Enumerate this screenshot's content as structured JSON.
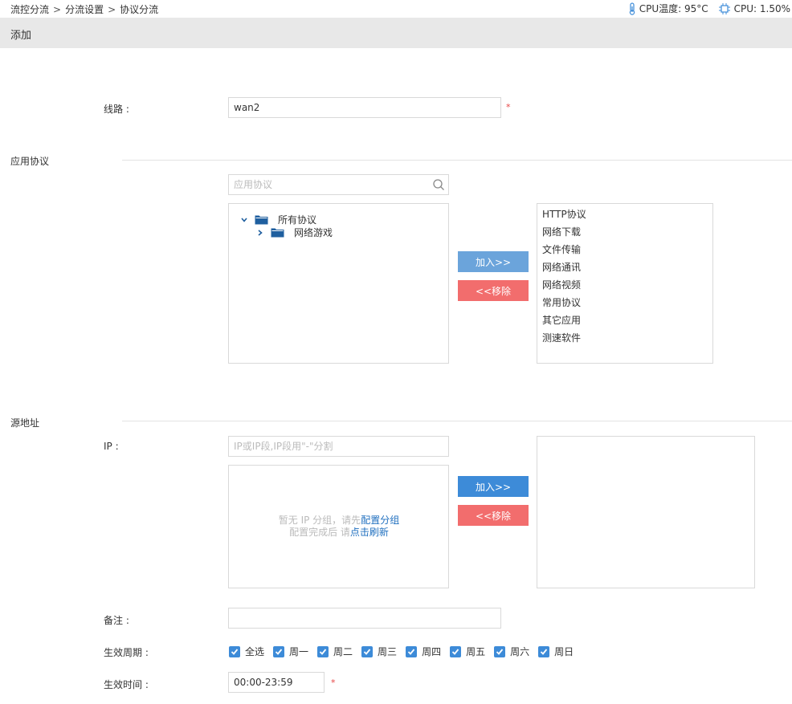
{
  "breadcrumb": {
    "items": [
      "流控分流",
      "分流设置",
      "协议分流"
    ],
    "separator": ">"
  },
  "stats": {
    "cpu_temp": "CPU温度: 95°C",
    "cpu_usage": "CPU: 1.50%"
  },
  "panel": {
    "title": "添加"
  },
  "line": {
    "label": "线路 :",
    "value": "wan2",
    "required": "*"
  },
  "protocol_section": {
    "title": "应用协议",
    "search_placeholder": "应用协议",
    "tree": {
      "root": "所有协议",
      "child": "网络游戏"
    },
    "add_button": "加入>>",
    "remove_button": "<<移除",
    "selected": [
      "HTTP协议",
      "网络下载",
      "文件传输",
      "网络通讯",
      "网络视频",
      "常用协议",
      "其它应用",
      "测速软件"
    ]
  },
  "source_section": {
    "title": "源地址",
    "ip_label": "IP :",
    "ip_placeholder": "IP或IP段,IP段用\"-\"分割",
    "empty_line1_prefix": "暂无 IP 分组，请先",
    "empty_line1_link": "配置分组",
    "empty_line2_prefix": "配置完成后 请",
    "empty_line2_link": "点击刷新",
    "add_button": "加入>>",
    "remove_button": "<<移除"
  },
  "remark": {
    "label": "备注 :",
    "value": ""
  },
  "period": {
    "label": "生效周期 :",
    "options": [
      "全选",
      "周一",
      "周二",
      "周三",
      "周四",
      "周五",
      "周六",
      "周日"
    ],
    "checked": [
      true,
      true,
      true,
      true,
      true,
      true,
      true,
      true
    ]
  },
  "time": {
    "label": "生效时间 :",
    "value": "00:00-23:59",
    "required": "*"
  },
  "colors": {
    "accent": "#3d8bd8",
    "danger": "#f26d6d",
    "link": "#1f6fbf",
    "header_bg": "#e8e8e8"
  },
  "icons": {
    "temp": "thermometer-icon",
    "cpu": "cpu-chip-icon",
    "search": "search-icon",
    "folder": "folder-icon",
    "check": "check-icon"
  }
}
